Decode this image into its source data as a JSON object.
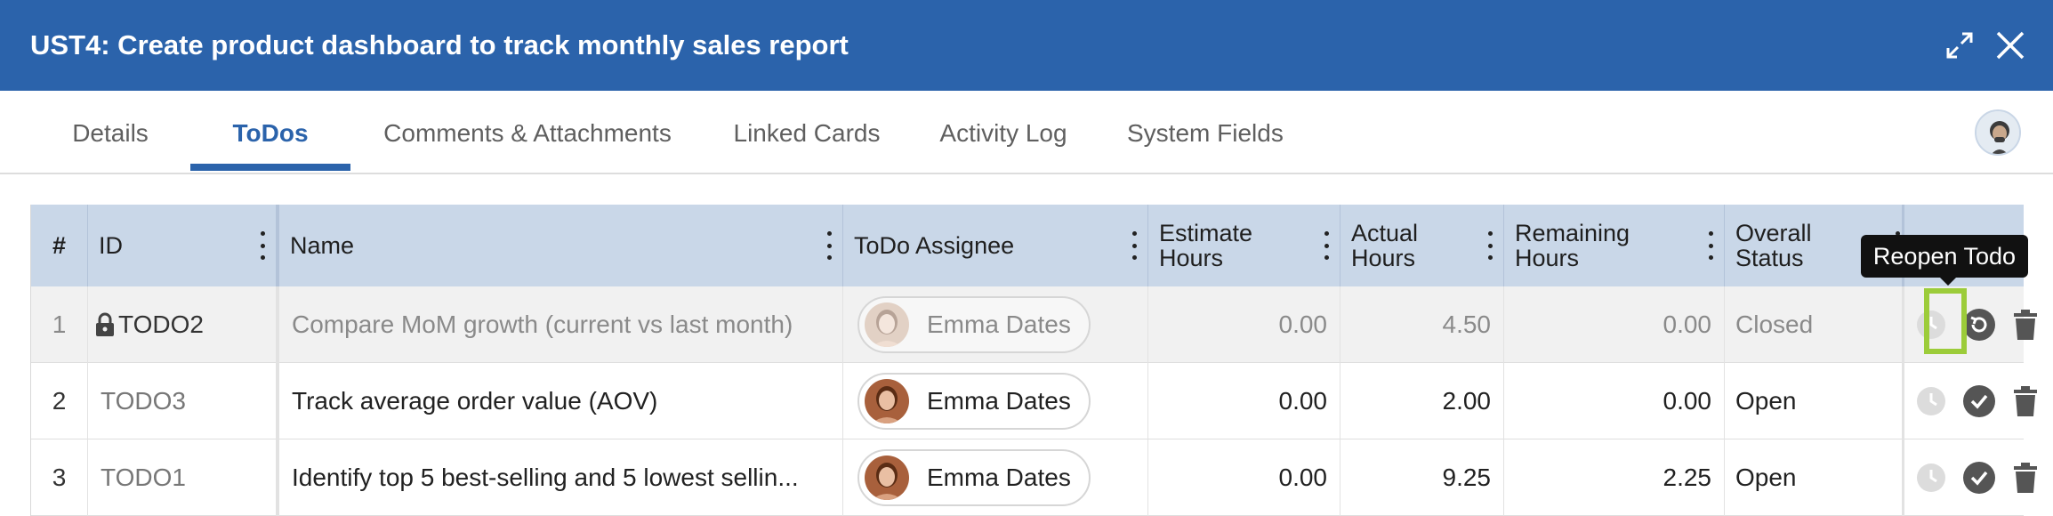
{
  "header": {
    "title": "UST4: Create product dashboard to track monthly sales report",
    "expand_icon": "expand-icon",
    "close_icon": "close-icon",
    "background": "#2b63ab"
  },
  "tabs": [
    {
      "label": "Details",
      "active": false
    },
    {
      "label": "ToDos",
      "active": true
    },
    {
      "label": "Comments & Attachments",
      "active": false
    },
    {
      "label": "Linked Cards",
      "active": false
    },
    {
      "label": "Activity Log",
      "active": false
    },
    {
      "label": "System Fields",
      "active": false
    }
  ],
  "grid": {
    "columns": {
      "num": "#",
      "id": "ID",
      "name": "Name",
      "assignee": "ToDo Assignee",
      "estimate_l1": "Estimate",
      "estimate_l2": "Hours",
      "actual_l1": "Actual",
      "actual_l2": "Hours",
      "remaining_l1": "Remaining",
      "remaining_l2": "Hours",
      "status_l1": "Overall",
      "status_l2": "Status"
    },
    "rows": [
      {
        "num": "1",
        "id": "TODO2",
        "name": "Compare MoM growth (current vs last month)",
        "assignee": "Emma Dates",
        "estimate": "0.00",
        "actual": "4.50",
        "remaining": "0.00",
        "status": "Closed",
        "locked": true
      },
      {
        "num": "2",
        "id": "TODO3",
        "name": "Track average order value (AOV)",
        "assignee": "Emma Dates",
        "estimate": "0.00",
        "actual": "2.00",
        "remaining": "0.00",
        "status": "Open",
        "locked": false
      },
      {
        "num": "3",
        "id": "TODO1",
        "name": "Identify top 5 best-selling and 5 lowest sellin...",
        "assignee": "Emma Dates",
        "estimate": "0.00",
        "actual": "9.25",
        "remaining": "2.25",
        "status": "Open",
        "locked": false
      }
    ]
  },
  "tooltip": {
    "text": "Reopen Todo"
  },
  "colors": {
    "accent": "#2b63ab",
    "header_row": "#c9d7e8",
    "highlight": "#9ccc3a"
  }
}
